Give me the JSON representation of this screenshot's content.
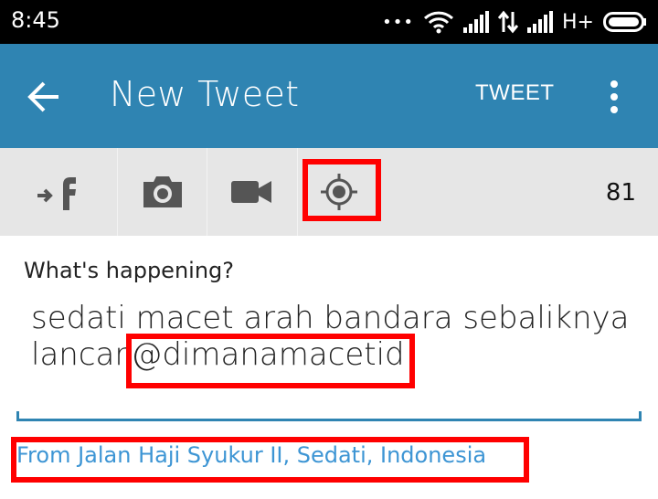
{
  "status_bar": {
    "time": "8:45",
    "dots": "•••",
    "network": "H+",
    "icons": [
      "wifi-icon",
      "signal-icon",
      "data-transfer-icon",
      "signal-icon",
      "battery-icon"
    ]
  },
  "app_bar": {
    "title": "New Tweet",
    "tweet_label": "TWEET",
    "color": "#2f84b2"
  },
  "toolbar": {
    "tools": [
      "facebook-share-icon",
      "camera-icon",
      "video-icon",
      "location-icon"
    ],
    "char_count": "81",
    "highlight_color": "#ff0000"
  },
  "compose": {
    "label": "What's happening?",
    "text_before": "sedati macet  arah bandara sebaliknya lancar",
    "mention": "@dimanamacetid",
    "location": "From Jalan Haji Syukur II, Sedati, Indonesia"
  }
}
